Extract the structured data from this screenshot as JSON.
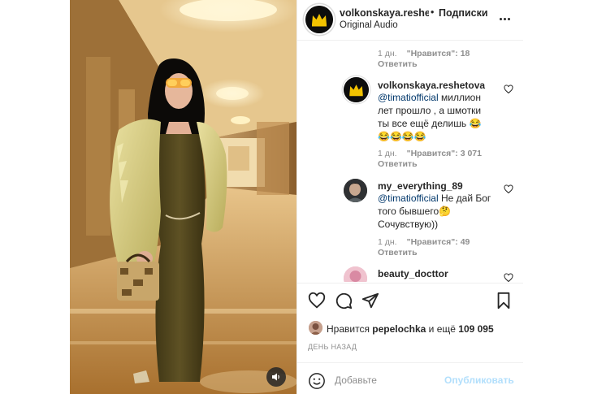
{
  "post": {
    "author": "volkonskaya.reshetova",
    "author_display": "volkonskaya.reshet",
    "separator": "•",
    "follow_label": "Подписки",
    "audio": "Original Audio",
    "more_icon": "more-horizontal-icon",
    "mute_icon": "speaker-icon",
    "avatar_icon": "crown-logo-icon"
  },
  "comments": [
    {
      "age": "1 дн.",
      "likes": "\"Нравится\": 18",
      "reply": "Ответить"
    },
    {
      "user": "volkonskaya.reshetova",
      "mention": "@timatiofficial",
      "text": " миллион лет прошло , а шмотки ты все ещё делишь 😂😂😂😂😂",
      "age": "1 дн.",
      "likes": "\"Нравится\": 3 071",
      "reply": "Ответить"
    },
    {
      "user": "my_everything_89",
      "mention": "@timatiofficial",
      "text": " Не дай Бог того бывшего🤔 Сочувствую))",
      "age": "1 дн.",
      "likes": "\"Нравится\": 49",
      "reply": "Ответить"
    },
    {
      "user": "beauty_docttor"
    }
  ],
  "actions": {
    "like_icon": "heart-icon",
    "comment_icon": "comment-icon",
    "share_icon": "paper-plane-icon",
    "save_icon": "bookmark-icon"
  },
  "likes": {
    "prefix": "Нравится ",
    "user": "pepelochka",
    "middle": " и ещё ",
    "count": "109 095"
  },
  "date": "ДЕНЬ НАЗАД",
  "compose": {
    "placeholder": "Добавьте",
    "publish_label": "Опубликовать",
    "emoji_icon": "smiley-icon"
  },
  "colors": {
    "link": "#00376b",
    "muted": "#8e8e8e",
    "publish_disabled": "#b2dffc",
    "text": "#262626"
  }
}
